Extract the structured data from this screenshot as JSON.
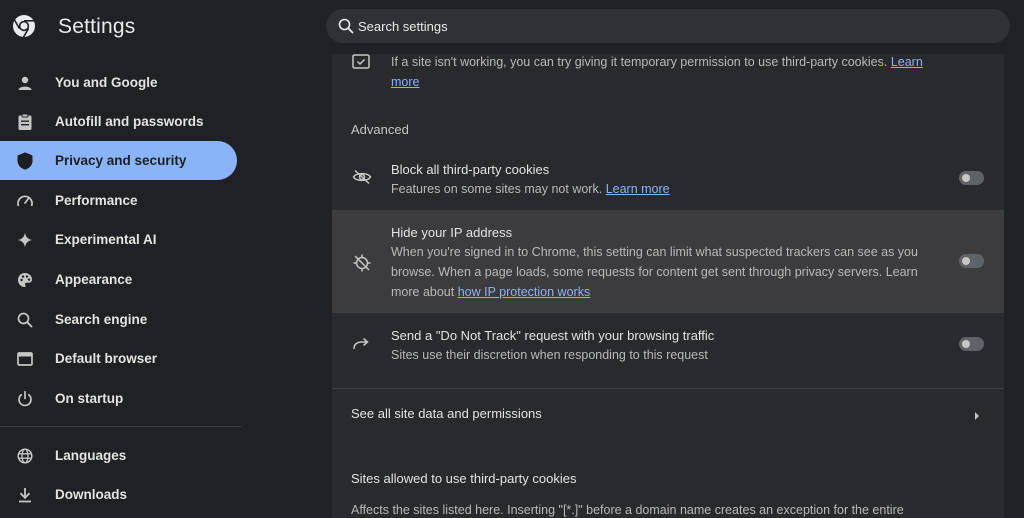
{
  "app": {
    "title": "Settings"
  },
  "search": {
    "placeholder": "Search settings"
  },
  "sidebar": {
    "items": [
      {
        "label": "You and Google",
        "icon": "person-icon"
      },
      {
        "label": "Autofill and passwords",
        "icon": "clipboard-icon"
      },
      {
        "label": "Privacy and security",
        "icon": "shield-icon",
        "active": true
      },
      {
        "label": "Performance",
        "icon": "speedometer-icon"
      },
      {
        "label": "Experimental AI",
        "icon": "sparkle-icon"
      },
      {
        "label": "Appearance",
        "icon": "palette-icon"
      },
      {
        "label": "Search engine",
        "icon": "search-icon"
      },
      {
        "label": "Default browser",
        "icon": "browser-window-icon"
      },
      {
        "label": "On startup",
        "icon": "power-icon"
      },
      {
        "label": "Languages",
        "icon": "globe-icon"
      },
      {
        "label": "Downloads",
        "icon": "download-icon"
      }
    ]
  },
  "main": {
    "temp_permission": {
      "text": "If a site isn't working, you can try giving it temporary permission to use third-party cookies.",
      "link": "Learn",
      "link_cont": "more"
    },
    "advanced_heading": "Advanced",
    "block_cookies": {
      "title": "Block all third-party cookies",
      "desc": "Features on some sites may not work.",
      "link": "Learn more",
      "enabled": false
    },
    "hide_ip": {
      "title": "Hide your IP address",
      "desc_line1": "When you're signed in to Chrome, this setting can limit what suspected trackers can see as you",
      "desc_line2": "browse. When a page loads, some requests for content get sent through privacy servers. Learn",
      "desc_line3_prefix": "more about",
      "link": "how IP protection works",
      "enabled": false
    },
    "do_not_track": {
      "title": "Send a \"Do Not Track\" request with your browsing traffic",
      "desc": "Sites use their discretion when responding to this request",
      "enabled": false
    },
    "site_data": {
      "label": "See all site data and permissions"
    },
    "allowed_sites": {
      "heading": "Sites allowed to use third-party cookies",
      "desc": "Affects the sites listed here. Inserting \"[*.]\" before a domain name creates an exception for the entire"
    }
  },
  "colors": {
    "accent": "#8ab4f8",
    "background": "#202124",
    "panel": "#292a2d"
  }
}
